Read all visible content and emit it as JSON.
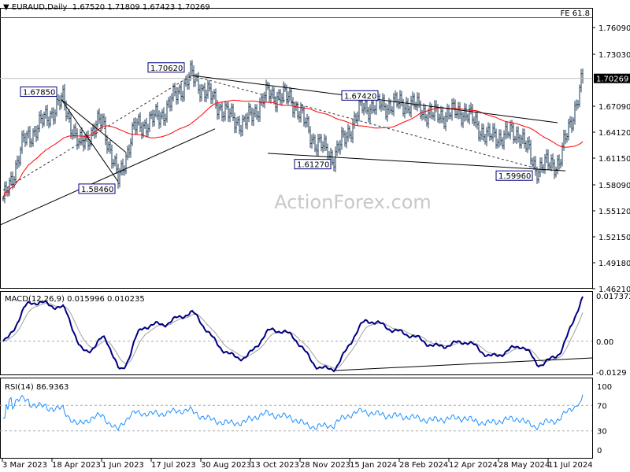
{
  "header": {
    "symbol": "EURAUD,Daily",
    "open": "1.67520",
    "high": "1.71809",
    "low": "1.67423",
    "close": "1.70269"
  },
  "watermark": "ActionForex.com",
  "fe_label": "FE 61.8",
  "colors": {
    "bars": "#1f3b57",
    "ma": "#ff0000",
    "macd": "#000080",
    "signal": "#a0a0a0",
    "rsi": "#1e90ff",
    "label_border": "#000080"
  },
  "chart_data": [
    {
      "type": "line",
      "title": "EURAUD Daily price (OHLC bars)",
      "ylim": [
        1.4621,
        1.7609
      ],
      "y_ticks": [
        "1.76090",
        "1.73030",
        "1.67090",
        "1.64120",
        "1.61150",
        "1.58090",
        "1.55120",
        "1.52150",
        "1.49180",
        "1.46210"
      ],
      "current_price": "1.70269",
      "x_labels": [
        "3 Mar 2023",
        "18 Apr 2023",
        "1 Jun 2023",
        "17 Jul 2023",
        "30 Aug 2023",
        "13 Oct 2023",
        "28 Nov 2023",
        "15 Jan 2024",
        "28 Feb 2024",
        "12 Apr 2024",
        "28 May 2024",
        "11 Jul 2024"
      ],
      "close_anchors": [
        [
          0,
          1.56
        ],
        [
          13,
          1.63
        ],
        [
          38,
          1.678
        ],
        [
          48,
          1.625
        ],
        [
          63,
          1.655
        ],
        [
          73,
          1.585
        ],
        [
          83,
          1.645
        ],
        [
          100,
          1.66
        ],
        [
          119,
          1.706
        ],
        [
          143,
          1.66
        ],
        [
          153,
          1.65
        ],
        [
          168,
          1.685
        ],
        [
          183,
          1.68
        ],
        [
          198,
          1.63
        ],
        [
          210,
          1.613
        ],
        [
          228,
          1.67
        ],
        [
          258,
          1.674
        ],
        [
          273,
          1.66
        ],
        [
          293,
          1.665
        ],
        [
          308,
          1.635
        ],
        [
          328,
          1.64
        ],
        [
          338,
          1.6
        ],
        [
          353,
          1.607
        ],
        [
          360,
          1.65
        ],
        [
          368,
          1.703
        ]
      ],
      "annotations": [
        {
          "label": "1.70620",
          "bar": 119,
          "price": 1.7062
        },
        {
          "label": "1.67850",
          "bar": 38,
          "price": 1.6785
        },
        {
          "label": "1.58460",
          "bar": 73,
          "price": 1.5846
        },
        {
          "label": "1.61270",
          "bar": 210,
          "price": 1.6127
        },
        {
          "label": "1.67420",
          "bar": 240,
          "price": 1.6742
        },
        {
          "label": "1.59960",
          "bar": 338,
          "price": 1.5996
        }
      ]
    },
    {
      "type": "line",
      "title": "MACD(12,26,9) 0.015996 0.010235",
      "y_ticks": [
        "0.017372",
        "0.00",
        "-0.0129"
      ],
      "ylim": [
        -0.0129,
        0.017372
      ]
    },
    {
      "type": "line",
      "title": "RSI(14) 86.9363",
      "y_ticks": [
        "100",
        "70",
        "30",
        "0"
      ],
      "ylim": [
        0,
        100
      ]
    }
  ]
}
